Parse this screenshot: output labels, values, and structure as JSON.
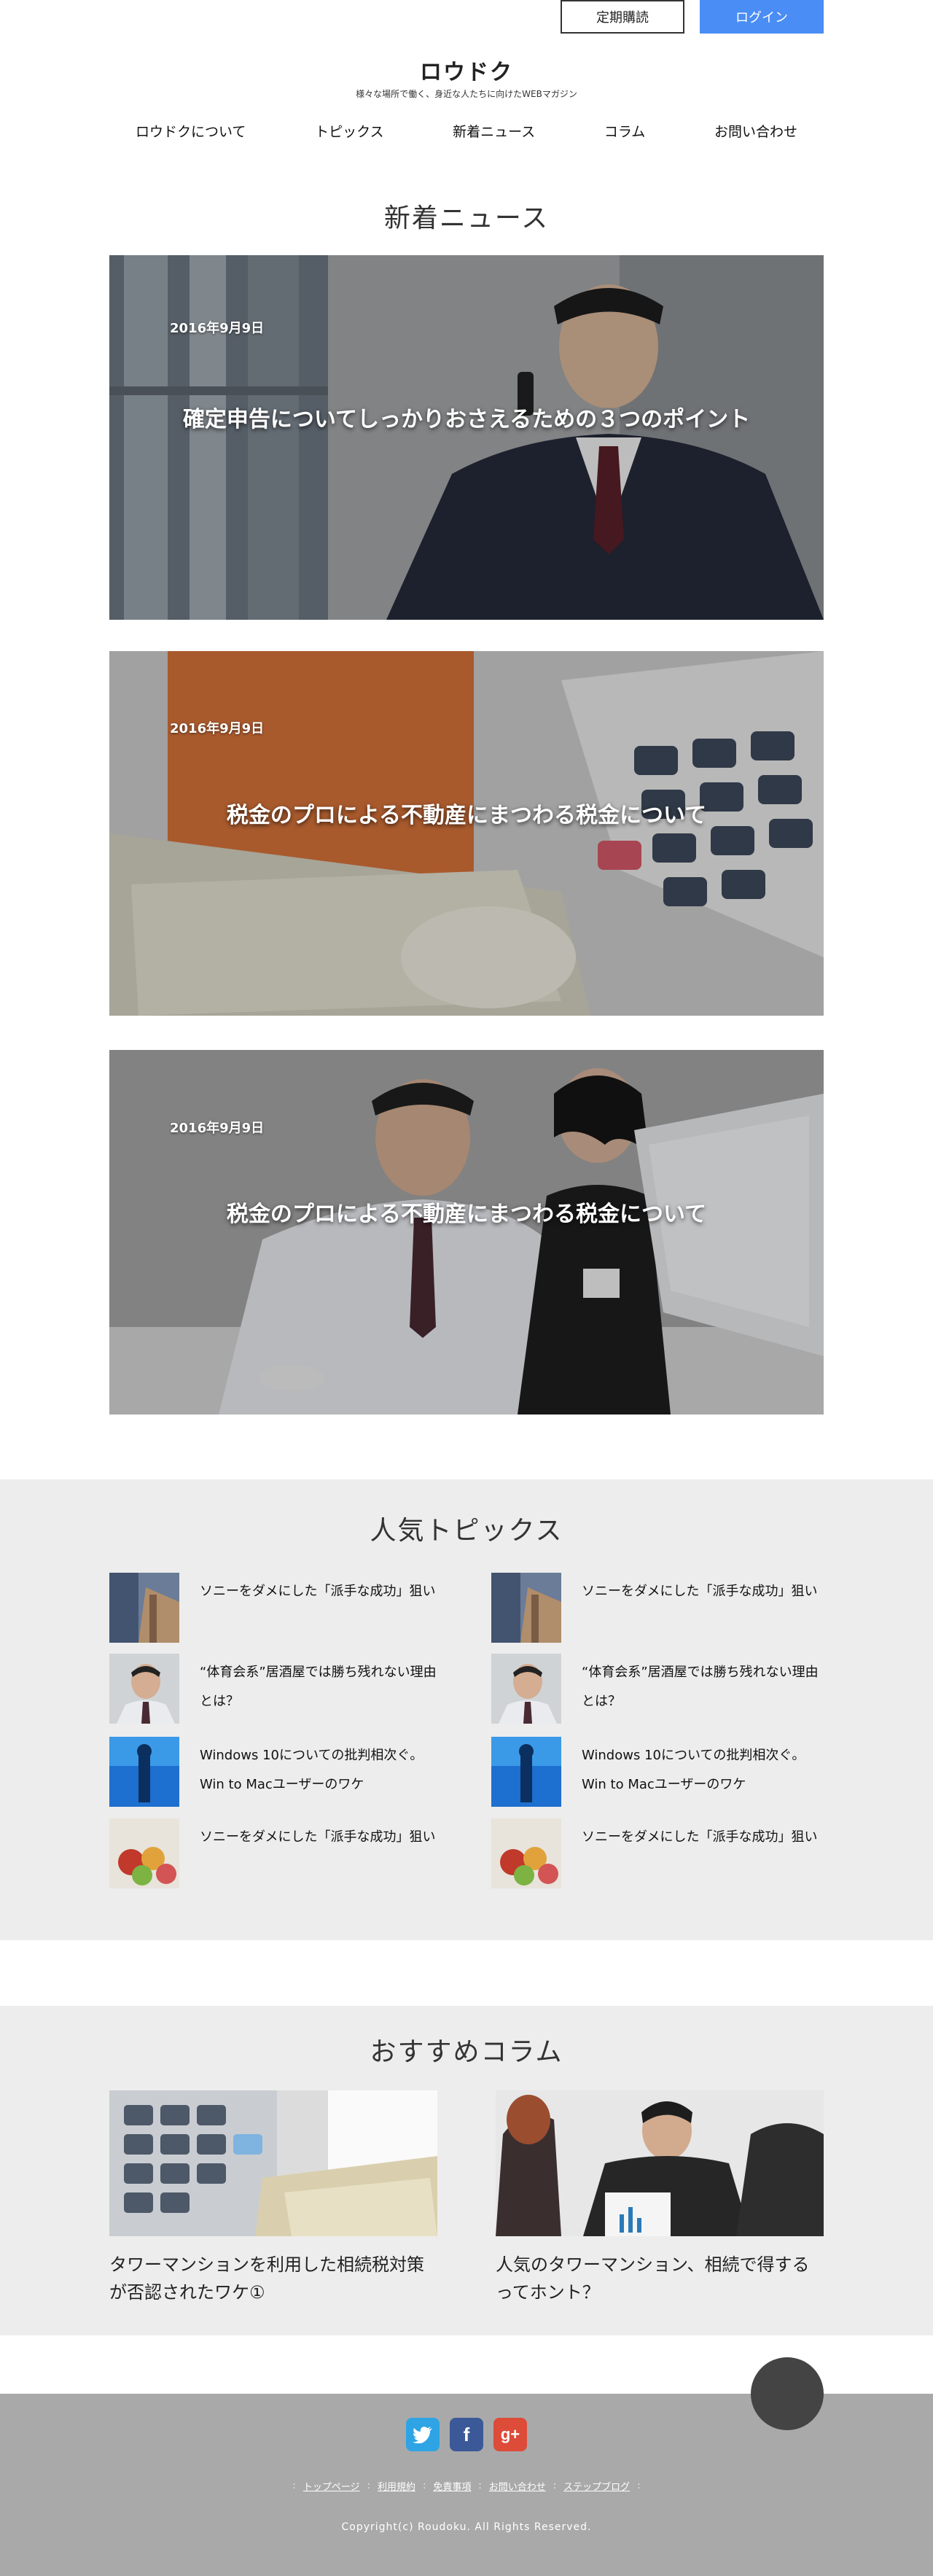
{
  "topbar": {
    "subscribe_label": "定期購読",
    "login_label": "ログイン"
  },
  "header": {
    "logo": "ロウドク",
    "tagline": "様々な場所で働く、身近な人たちに向けたWEBマガジン"
  },
  "nav": {
    "items": [
      "ロウドクについて",
      "トピックス",
      "新着ニュース",
      "コラム",
      "お問い合わせ"
    ]
  },
  "news": {
    "title": "新着ニュース",
    "items": [
      {
        "date": "2016年9月9日",
        "title": "確定申告についてしっかりおさえるための３つのポイント"
      },
      {
        "date": "2016年9月9日",
        "title": "税金のプロによる不動産にまつわる税金について"
      },
      {
        "date": "2016年9月9日",
        "title": "税金のプロによる不動産にまつわる税金について"
      }
    ]
  },
  "topics": {
    "title": "人気トピックス",
    "left": [
      {
        "text": "ソニーをダメにした「派手な成功」狙い"
      },
      {
        "text": "“体育会系”居酒屋では勝ち残れない理由とは？"
      },
      {
        "text": "Windows 10についての批判相次ぐ。Win to Macユーザーのワケ"
      },
      {
        "text": "ソニーをダメにした「派手な成功」狙い"
      }
    ],
    "right": [
      {
        "text": "ソニーをダメにした「派手な成功」狙い"
      },
      {
        "text": "“体育会系”居酒屋では勝ち残れない理由とは？"
      },
      {
        "text": "Windows 10についての批判相次ぐ。Win to Macユーザーのワケ"
      },
      {
        "text": "ソニーをダメにした「派手な成功」狙い"
      }
    ]
  },
  "columns": {
    "title": "おすすめコラム",
    "items": [
      {
        "title": "タワーマンションを利用した相続税対策が否認されたワケ①"
      },
      {
        "title": "人気のタワーマンション、相続で得するってホント？"
      }
    ]
  },
  "footer": {
    "social": [
      "twitter-icon",
      "facebook-icon",
      "google-plus-icon"
    ],
    "links": [
      "トップページ",
      "利用規約",
      "免責事項",
      "お問い合わせ",
      "ステップブログ"
    ],
    "copyright": "Copyright(c) Roudoku. All Rights Reserved."
  },
  "colors": {
    "accent": "#4a8df4",
    "section_bg": "#ededed",
    "footer_bg": "#a9a9a9",
    "totop": "#444444"
  }
}
